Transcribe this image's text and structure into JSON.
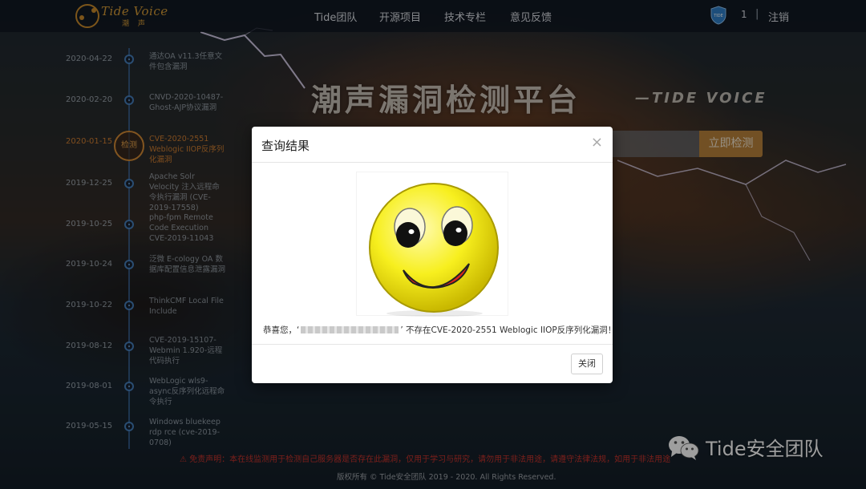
{
  "brand": {
    "title": "Tide Voice",
    "subtitle": "潮 声"
  },
  "nav": {
    "items": [
      "Tide团队",
      "开源项目",
      "技术专栏",
      "意见反馈"
    ],
    "user_count": "1",
    "separator": "|",
    "logout": "注销",
    "shield_text": "TIDE"
  },
  "hero": {
    "title": "潮声漏洞检测平台",
    "subtitle": "—TIDE VOICE",
    "search_button": "立即检测"
  },
  "timeline": {
    "active_label": "检测",
    "items": [
      {
        "date": "2020-04-22",
        "text": "通达OA v11.3任意文件包含漏洞"
      },
      {
        "date": "2020-02-20",
        "text": "CNVD-2020-10487-Ghost-AJP协议漏洞"
      },
      {
        "date": "2020-01-15",
        "text": "CVE-2020-2551 Weblogic IIOP反序列化漏洞"
      },
      {
        "date": "2019-12-25",
        "text": "Apache Solr Velocity 注入远程命令执行漏洞 (CVE-2019-17558)"
      },
      {
        "date": "2019-10-25",
        "text": "php-fpm Remote Code Execution CVE-2019-11043"
      },
      {
        "date": "2019-10-24",
        "text": "泛微 E-cology OA 数据库配置信息泄露漏洞"
      },
      {
        "date": "2019-10-22",
        "text": "ThinkCMF Local File Include"
      },
      {
        "date": "2019-08-12",
        "text": "CVE-2019-15107-Webmin 1.920-远程代码执行"
      },
      {
        "date": "2019-08-01",
        "text": "WebLogic wls9-async反序列化远程命令执行"
      },
      {
        "date": "2019-05-15",
        "text": "Windows bluekeep rdp rce (cve-2019-0708)"
      }
    ]
  },
  "footer": {
    "warning": "⚠ 免责声明：本在线监测用于检测自己服务器是否存在此漏洞，仅用于学习与研究，请勿用于非法用途，请遵守法律法规，如用于非法用途",
    "copyright": "版权所有 © Tide安全团队 2019 - 2020. All Rights Reserved.",
    "watermark": "Tide安全团队"
  },
  "modal": {
    "title": "查询结果",
    "close_symbol": "×",
    "message_prefix": "恭喜您，‘",
    "message_suffix": "’ 不存在CVE-2020-2551 Weblogic IIOP反序列化漏洞！",
    "close_button": "关闭"
  },
  "colors": {
    "accent": "#b9823a",
    "timeline_active": "#d28a35",
    "warning": "#c8322b"
  }
}
